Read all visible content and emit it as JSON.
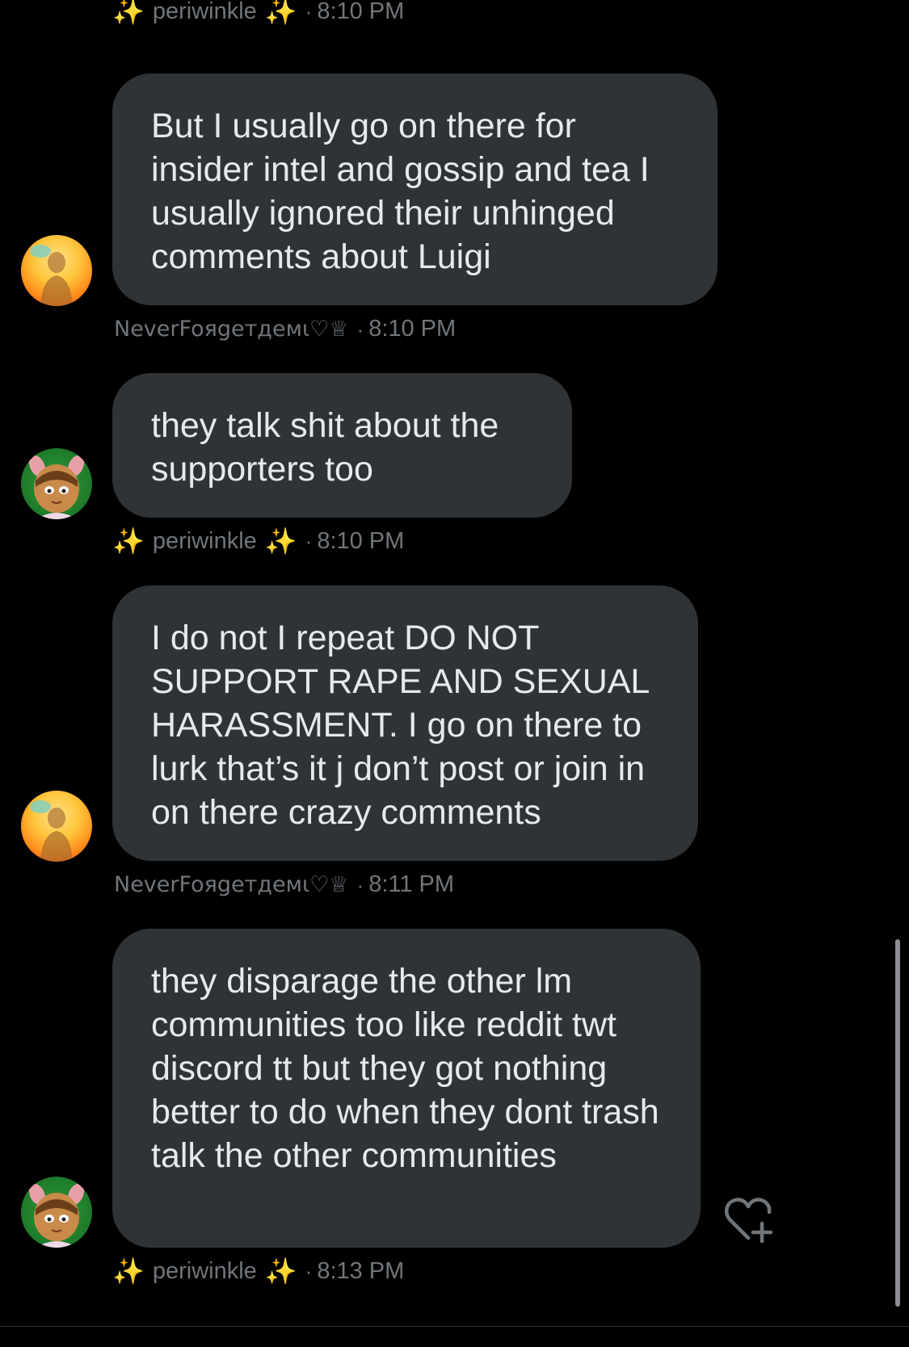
{
  "messages": [
    {
      "type": "meta",
      "sender_prefix": "✨",
      "sender_name": "periwinkle",
      "sender_suffix": "✨",
      "separator": "·",
      "time": "8:10 PM"
    },
    {
      "type": "bubble",
      "avatar": "sunset-photo-avatar",
      "text": "But I usually go on there for insider intel and gossip and tea I usually ignored their unhinged comments about Luigi"
    },
    {
      "type": "meta",
      "sender_name": "NeverFoяgeтдeмι♡♕",
      "separator": "·",
      "time": "8:10 PM"
    },
    {
      "type": "bubble",
      "avatar": "cartoon-girl-avatar",
      "text": "they talk shit about the supporters too"
    },
    {
      "type": "meta",
      "sender_prefix": "✨",
      "sender_name": "periwinkle",
      "sender_suffix": "✨",
      "separator": "·",
      "time": "8:10 PM"
    },
    {
      "type": "bubble",
      "avatar": "sunset-photo-avatar",
      "text": "I do not I repeat DO NOT SUPPORT RAPE AND SEXUAL HARASSMENT. I go on there to lurk that’s it j don’t post or join in on there crazy comments"
    },
    {
      "type": "meta",
      "sender_name": "NeverFoяgeтдeмι♡♕",
      "separator": "·",
      "time": "8:11 PM"
    },
    {
      "type": "bubble",
      "avatar": "cartoon-girl-avatar",
      "text": "they disparage the other lm communities too like reddit twt discord tt but they got nothing better to do when they dont trash talk the other communities"
    },
    {
      "type": "meta",
      "sender_prefix": "✨",
      "sender_name": "periwinkle",
      "sender_suffix": "✨",
      "separator": "·",
      "time": "8:13 PM"
    }
  ],
  "actions": {
    "react_icon": "heart-plus-icon"
  },
  "colors": {
    "background": "#000000",
    "bubble": "#2f3336",
    "text": "#e7e9ea",
    "meta": "#71767b",
    "sparkle": "#f5c518"
  }
}
